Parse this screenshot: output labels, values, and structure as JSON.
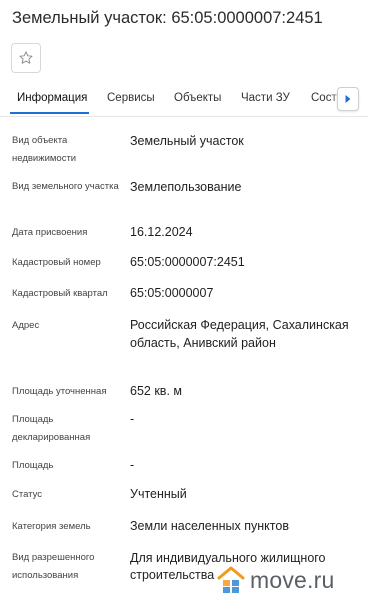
{
  "header": {
    "title": "Земельный участок: 65:05:0000007:2451"
  },
  "favorite": {
    "icon": "star-outline-icon"
  },
  "tabs": [
    {
      "label": "Информация",
      "active": true
    },
    {
      "label": "Сервисы"
    },
    {
      "label": "Объекты"
    },
    {
      "label": "Части ЗУ"
    },
    {
      "label": "Соста"
    }
  ],
  "tabs_scroll": {
    "icon": "triangle-right-icon"
  },
  "fields": [
    {
      "label": "Вид объекта недвижимости",
      "value": "Земельный участок"
    },
    {
      "label": "Вид земельного участка",
      "value": "Землепользование"
    },
    {
      "label": "Дата присвоения",
      "value": "16.12.2024"
    },
    {
      "label": "Кадастровый номер",
      "value": "65:05:0000007:2451"
    },
    {
      "label": "Кадастровый квартал",
      "value": "65:05:0000007"
    },
    {
      "label": "Адрес",
      "value": "Российская Федерация, Сахалинская область, Анивский район"
    },
    {
      "label": "Площадь уточненная",
      "value": "652 кв. м"
    },
    {
      "label": "Площадь декларированная",
      "value": "-"
    },
    {
      "label": "Площадь",
      "value": "-"
    },
    {
      "label": "Статус",
      "value": "Учтенный"
    },
    {
      "label": "Категория земель",
      "value": "Земли населенных пунктов"
    },
    {
      "label": "Вид разрешенного использования",
      "value": "Для индивидуального жилищного строительства"
    }
  ],
  "watermark": {
    "text": "move.ru",
    "colors": {
      "orange": "#f39a1e",
      "blue": "#2f86d4",
      "gray": "#5a5f66"
    }
  },
  "colors": {
    "accent": "#1e6fd9"
  }
}
